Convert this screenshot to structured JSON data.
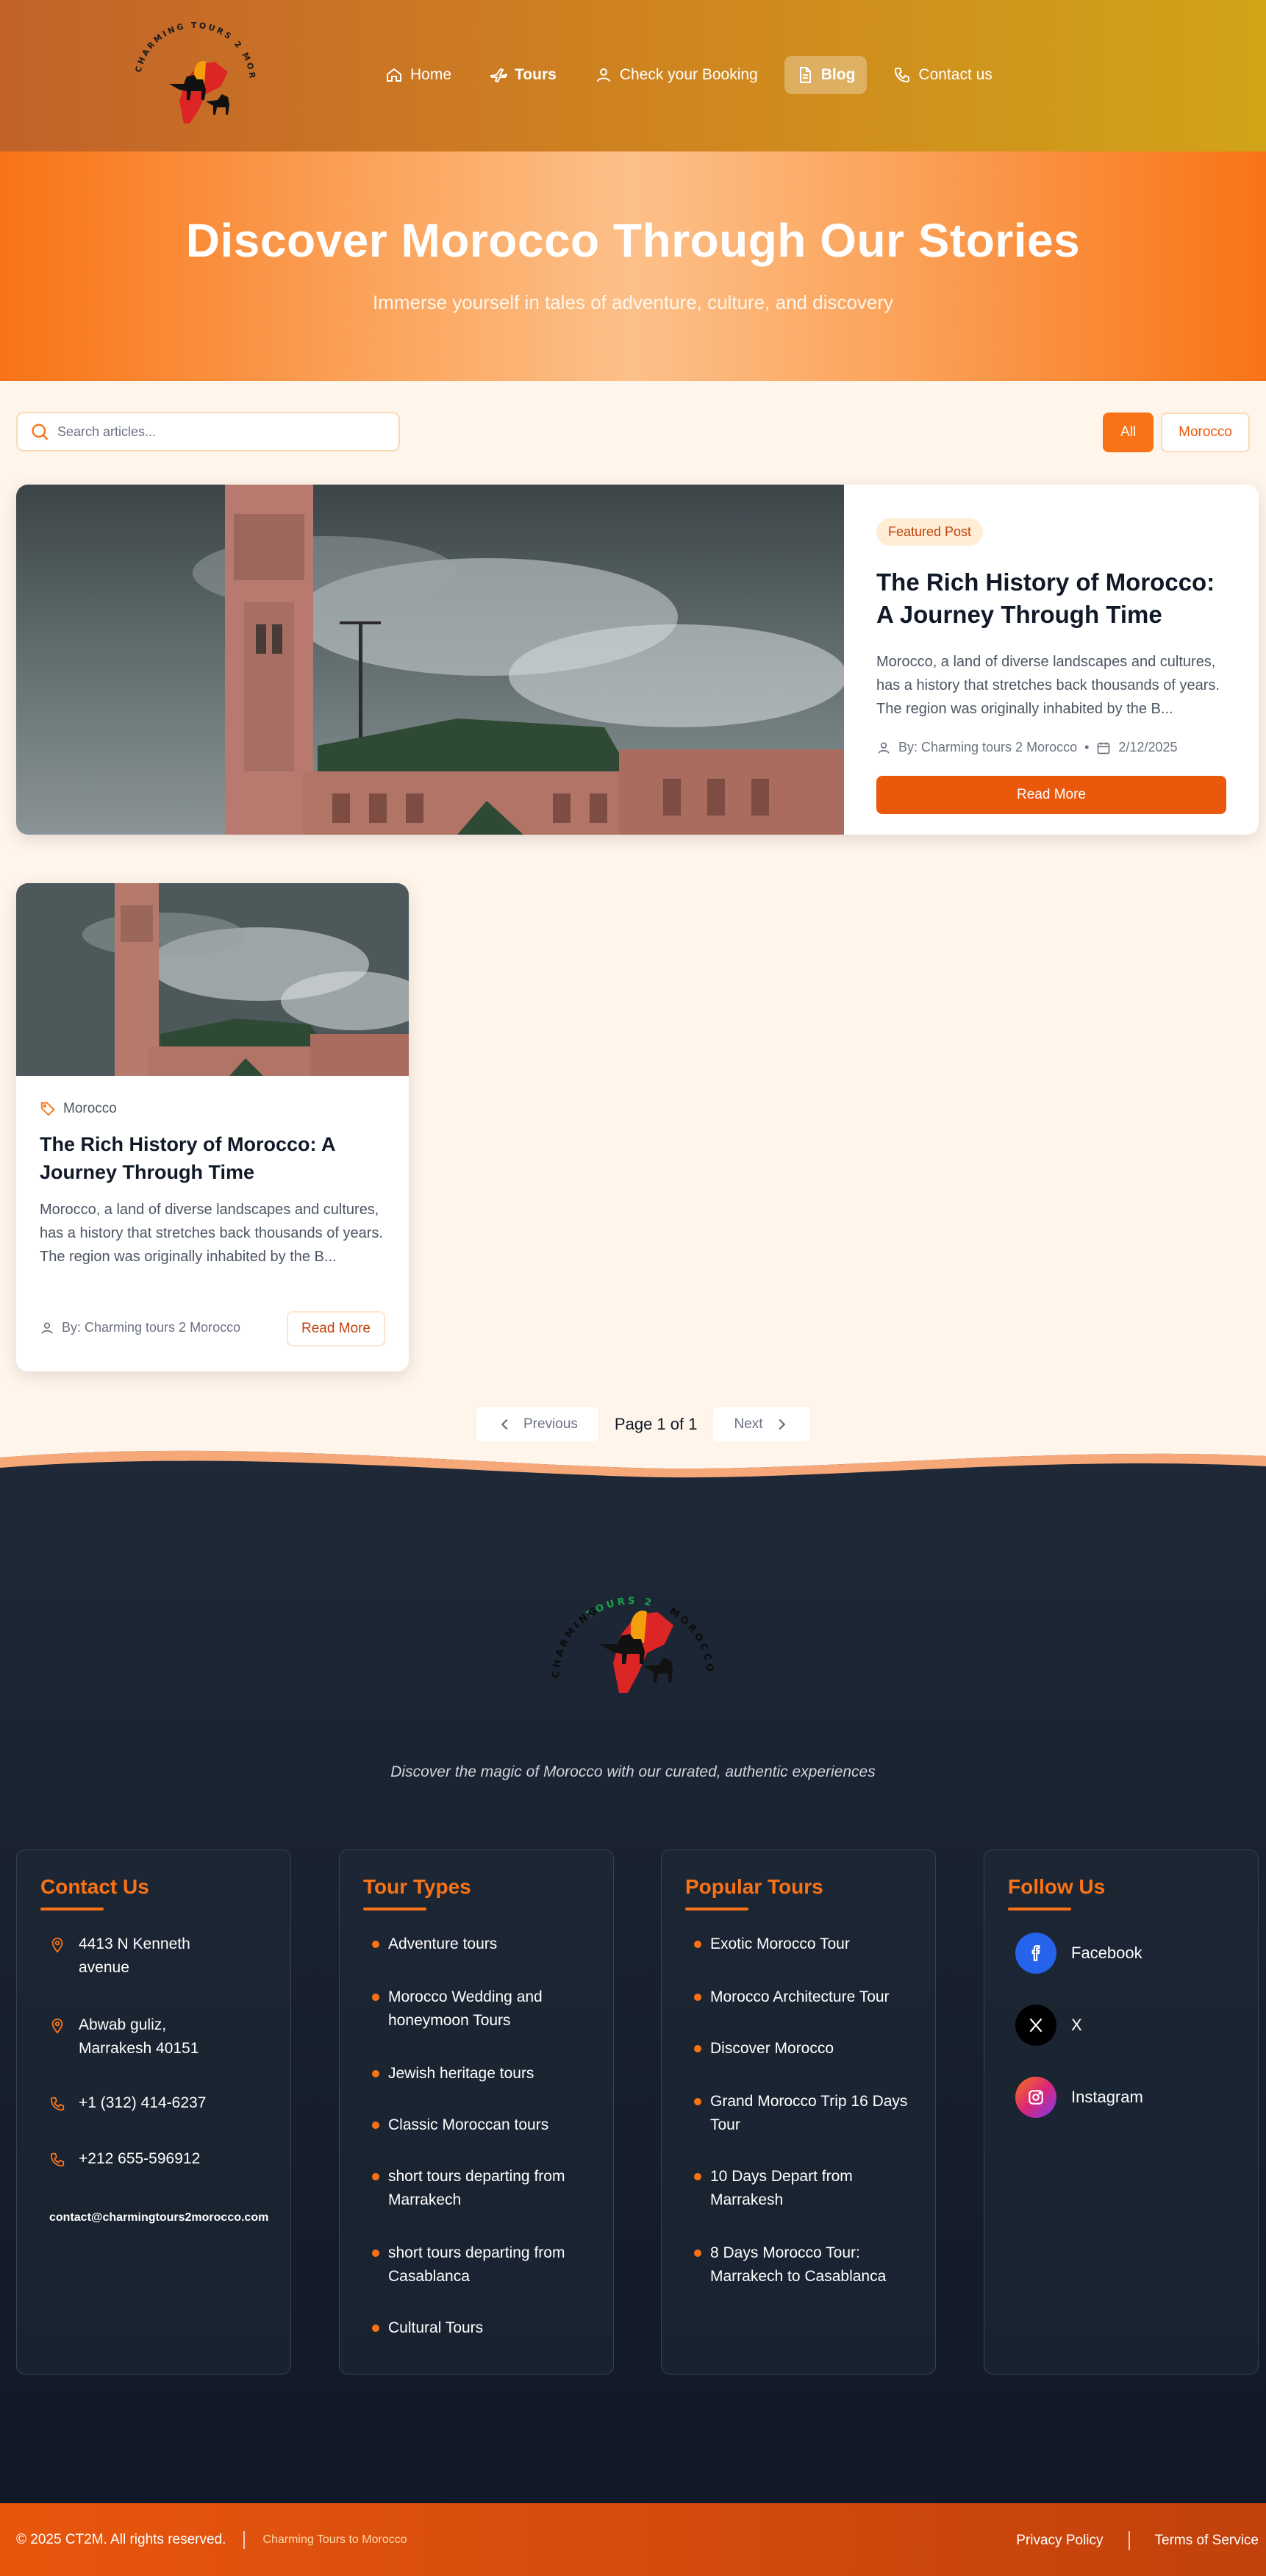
{
  "nav": {
    "items": [
      {
        "label": "Home",
        "icon": "home-icon"
      },
      {
        "label": "Tours",
        "icon": "plane-icon"
      },
      {
        "label": "Check your Booking",
        "icon": "user-icon"
      },
      {
        "label": "Blog",
        "icon": "document-icon",
        "active": true
      },
      {
        "label": "Contact us",
        "icon": "phone-icon"
      }
    ]
  },
  "logo": {
    "text": "CHARMING TOURS 2 MOROCCO"
  },
  "hero": {
    "title": "Discover Morocco Through Our Stories",
    "subtitle": "Immerse yourself in tales of adventure, culture, and discovery"
  },
  "search": {
    "placeholder": "Search articles..."
  },
  "filters": {
    "all": "All",
    "morocco": "Morocco",
    "active": "All"
  },
  "featured": {
    "badge": "Featured Post",
    "title": "The Rich History of Morocco: A Journey Through Time",
    "excerpt": "Morocco, a land of diverse landscapes and cultures, has a history that stretches back thousands of years. The region was originally inhabited by the B...",
    "author": "By: Charming tours 2 Morocco",
    "date": "2/12/2025",
    "button": "Read More"
  },
  "card": {
    "category": "Morocco",
    "title": "The Rich History of Morocco: A Journey Through Time",
    "excerpt": "Morocco, a land of diverse landscapes and cultures, has a history that stretches back thousands of years. The region was originally inhabited by the B...",
    "author": "By: Charming tours 2 Morocco",
    "button": "Read More"
  },
  "pagination": {
    "previous": "Previous",
    "info": "Page 1 of 1",
    "next": "Next"
  },
  "footer": {
    "tagline": "Discover the magic of Morocco with our curated, authentic experiences",
    "contact": {
      "title": "Contact Us",
      "address1": "4413 N Kenneth avenue",
      "address2": "Abwab guliz, Marrakesh 40151",
      "phone1": "+1 (312) 414-6237",
      "phone2": "+212 655-596912",
      "email": "contact@charmingtours2morocco.com"
    },
    "tour_types": {
      "title": "Tour Types",
      "items": [
        "Adventure tours",
        "Morocco Wedding and honeymoon Tours",
        "Jewish heritage tours",
        "Classic Moroccan tours",
        "short tours departing from Marrakech",
        "short tours departing from Casablanca",
        "Cultural Tours"
      ]
    },
    "popular_tours": {
      "title": "Popular Tours",
      "items": [
        "Exotic Morocco Tour",
        "Morocco Architecture Tour",
        "Discover Morocco",
        "Grand Morocco Trip 16 Days Tour",
        "10 Days Depart from Marrakesh",
        "8 Days Morocco Tour: Marrakech to Casablanca"
      ]
    },
    "follow": {
      "title": "Follow Us",
      "facebook": "Facebook",
      "x": "X",
      "instagram": "Instagram"
    }
  },
  "bottom": {
    "copyright": "© 2025 CT2M. All rights reserved.",
    "brand": "Charming Tours to Morocco",
    "privacy": "Privacy Policy",
    "terms": "Terms of Service"
  },
  "colors": {
    "accent": "#f97316",
    "accent_dark": "#ea580c",
    "footer_bg": "#1f2937",
    "page_bg": "#fff5eb"
  }
}
